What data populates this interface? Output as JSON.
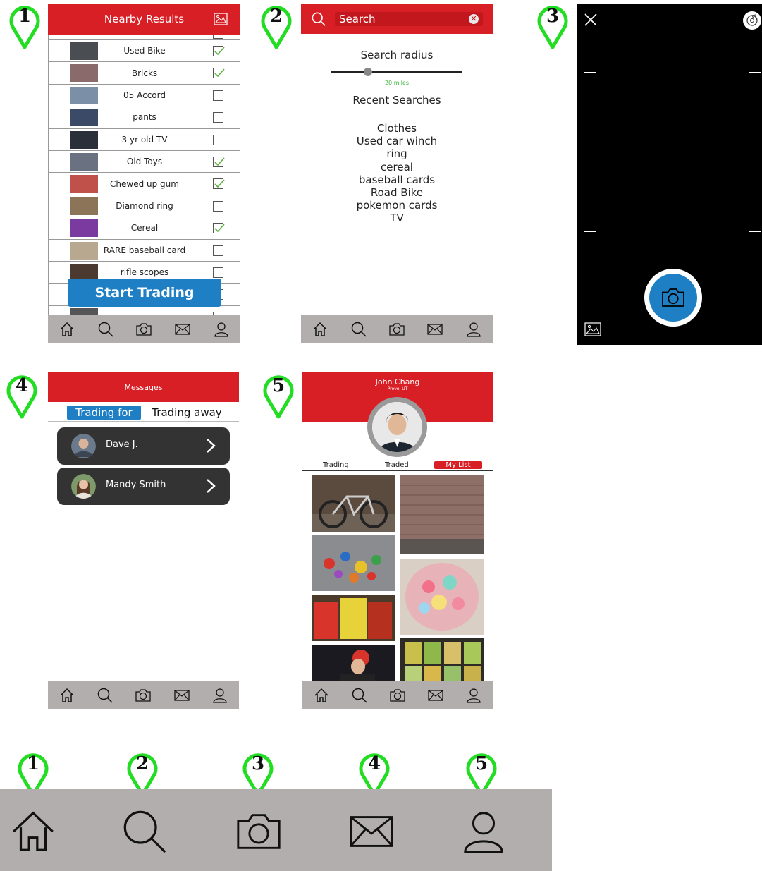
{
  "pins": [
    "1",
    "2",
    "3",
    "4",
    "5"
  ],
  "nav": [
    "home-icon",
    "search-icon",
    "camera-icon",
    "mail-icon",
    "profile-icon"
  ],
  "nearby": {
    "title": "Nearby Results",
    "items": [
      {
        "label": "Used Bike",
        "checked": true
      },
      {
        "label": "Bricks",
        "checked": true
      },
      {
        "label": "05 Accord",
        "checked": false
      },
      {
        "label": "pants",
        "checked": false
      },
      {
        "label": "3 yr old TV",
        "checked": false
      },
      {
        "label": "Old Toys",
        "checked": true
      },
      {
        "label": "Chewed up gum",
        "checked": true
      },
      {
        "label": "Diamond ring",
        "checked": false
      },
      {
        "label": "Cereal",
        "checked": true
      },
      {
        "label": "RARE baseball card",
        "checked": false
      },
      {
        "label": "rifle scopes",
        "checked": false
      }
    ],
    "start_label": "Start Trading"
  },
  "search": {
    "placeholder": "Search",
    "radius_label": "Search radius",
    "radius_value": "20 miles",
    "radius_fraction": 0.28,
    "recent_label": "Recent Searches",
    "recent": [
      "Clothes",
      "Used car winch",
      "ring",
      "cereal",
      "baseball cards",
      "Road Bike",
      "pokemon cards",
      "TV"
    ]
  },
  "messages": {
    "title": "Messages",
    "tab_active": "Trading for",
    "tab_other": "Trading away",
    "threads": [
      "Dave J.",
      "Mandy Smith"
    ]
  },
  "profile": {
    "name": "John Chang",
    "location": "Provo, UT",
    "tabs": [
      "Trading",
      "Traded",
      "My List"
    ],
    "active_tab": "My List"
  },
  "colors": {
    "brand_red": "#d91f26",
    "accent_blue": "#1e7fc4",
    "nav_gray": "#b2aeae",
    "pin_green": "#22dd22"
  }
}
